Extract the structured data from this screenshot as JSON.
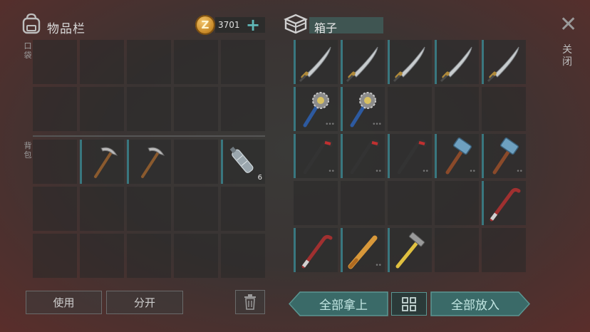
{
  "inventory": {
    "title": "物品栏",
    "pocket_label": "口袋",
    "backpack_label": "背包",
    "coin_symbol": "Z",
    "coin_count": "3701",
    "plus_label": "+",
    "pocket_slots": [
      {
        "item": null
      },
      {
        "item": null
      },
      {
        "item": null
      },
      {
        "item": null
      },
      {
        "item": null
      },
      {
        "item": null
      },
      {
        "item": null
      },
      {
        "item": null
      },
      {
        "item": null
      },
      {
        "item": null
      }
    ],
    "backpack_slots": [
      {
        "item": null
      },
      {
        "item": "pickaxe",
        "qty": ""
      },
      {
        "item": "pickaxe",
        "qty": ""
      },
      {
        "item": null
      },
      {
        "item": "water-bottle",
        "qty": "6"
      },
      {
        "item": null
      },
      {
        "item": null
      },
      {
        "item": null
      },
      {
        "item": null
      },
      {
        "item": null
      },
      {
        "item": null
      },
      {
        "item": null
      },
      {
        "item": null
      },
      {
        "item": null
      },
      {
        "item": null
      }
    ]
  },
  "box": {
    "title": "箱子",
    "slots": [
      {
        "item": "machete"
      },
      {
        "item": "machete"
      },
      {
        "item": "machete"
      },
      {
        "item": "machete"
      },
      {
        "item": "machete"
      },
      {
        "item": "spiked-club"
      },
      {
        "item": "spiked-club"
      },
      {
        "item": null
      },
      {
        "item": null
      },
      {
        "item": null
      },
      {
        "item": "crowbar"
      },
      {
        "item": "crowbar"
      },
      {
        "item": "crowbar"
      },
      {
        "item": "sledgehammer"
      },
      {
        "item": "sledgehammer"
      },
      {
        "item": null
      },
      {
        "item": null
      },
      {
        "item": null
      },
      {
        "item": null
      },
      {
        "item": "red-crowbar"
      },
      {
        "item": "red-crowbar"
      },
      {
        "item": "baseball-bat"
      },
      {
        "item": "hammer"
      },
      {
        "item": null
      },
      {
        "item": null
      }
    ]
  },
  "close_label": "关闭",
  "buttons": {
    "use": "使用",
    "split": "分开",
    "take_all": "全部拿上",
    "put_all": "全部放入"
  },
  "colors": {
    "accent_teal": "#3a6a68",
    "slot_stripe": "#3c8a94"
  }
}
